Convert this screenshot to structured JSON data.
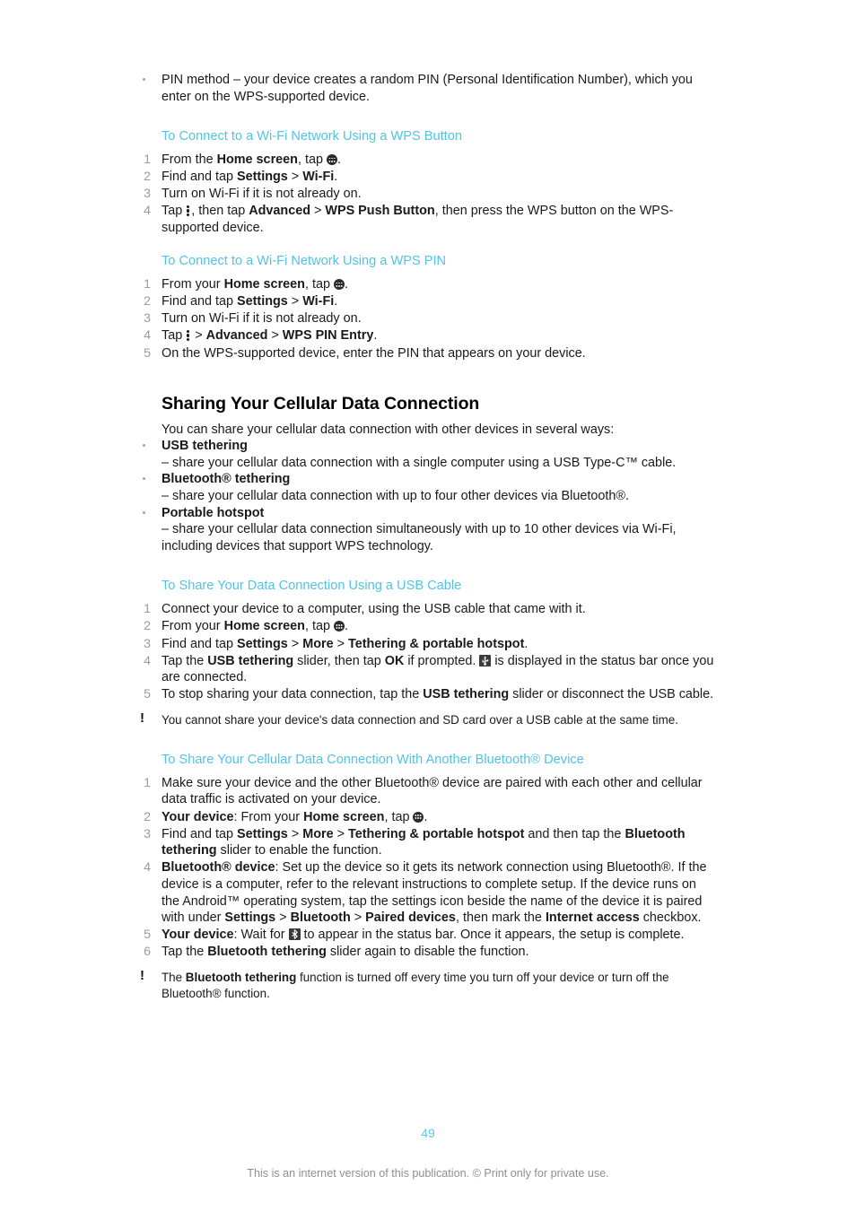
{
  "page": {
    "number": "49",
    "footer_note": "This is an internet version of this publication. © Print only for private use."
  },
  "top_bullet": {
    "text_part1": "PIN method – your device creates a random PIN (Personal Identification Number), which you enter on the WPS-supported device."
  },
  "section_wps_button": {
    "heading": "To Connect to a Wi-Fi Network Using a WPS Button",
    "steps": [
      {
        "num": "1",
        "parts": [
          {
            "t": "From the ",
            "b": false
          },
          {
            "t": "Home screen",
            "b": true
          },
          {
            "t": ", tap ",
            "b": false
          },
          {
            "icon": "app-drawer-icon"
          },
          {
            "t": ".",
            "b": false
          }
        ]
      },
      {
        "num": "2",
        "parts": [
          {
            "t": "Find and tap ",
            "b": false
          },
          {
            "t": "Settings",
            "b": true
          },
          {
            "t": " > ",
            "b": false
          },
          {
            "t": "Wi-Fi",
            "b": true
          },
          {
            "t": ".",
            "b": false
          }
        ]
      },
      {
        "num": "3",
        "parts": [
          {
            "t": "Turn on Wi-Fi if it is not already on.",
            "b": false
          }
        ]
      },
      {
        "num": "4",
        "parts": [
          {
            "t": "Tap ",
            "b": false
          },
          {
            "icon": "overflow-menu-icon"
          },
          {
            "t": ", then tap ",
            "b": false
          },
          {
            "t": "Advanced",
            "b": true
          },
          {
            "t": " > ",
            "b": false
          },
          {
            "t": "WPS Push Button",
            "b": true
          },
          {
            "t": ", then press the WPS button on the WPS-supported device.",
            "b": false
          }
        ]
      }
    ]
  },
  "section_wps_pin": {
    "heading": "To Connect to a Wi-Fi Network Using a WPS PIN",
    "steps": [
      {
        "num": "1",
        "parts": [
          {
            "t": "From your ",
            "b": false
          },
          {
            "t": "Home screen",
            "b": true
          },
          {
            "t": ", tap ",
            "b": false
          },
          {
            "icon": "app-drawer-icon"
          },
          {
            "t": ".",
            "b": false
          }
        ]
      },
      {
        "num": "2",
        "parts": [
          {
            "t": "Find and tap ",
            "b": false
          },
          {
            "t": "Settings",
            "b": true
          },
          {
            "t": " > ",
            "b": false
          },
          {
            "t": "Wi-Fi",
            "b": true
          },
          {
            "t": ".",
            "b": false
          }
        ]
      },
      {
        "num": "3",
        "parts": [
          {
            "t": "Turn on Wi-Fi if it is not already on.",
            "b": false
          }
        ]
      },
      {
        "num": "4",
        "parts": [
          {
            "t": "Tap ",
            "b": false
          },
          {
            "icon": "overflow-menu-icon"
          },
          {
            "t": " > ",
            "b": false
          },
          {
            "t": "Advanced",
            "b": true
          },
          {
            "t": " > ",
            "b": false
          },
          {
            "t": "WPS PIN Entry",
            "b": true
          },
          {
            "t": ".",
            "b": false
          }
        ]
      },
      {
        "num": "5",
        "parts": [
          {
            "t": "On the WPS-supported device, enter the PIN that appears on your device.",
            "b": false
          }
        ]
      }
    ]
  },
  "section_sharing": {
    "title": "Sharing Your Cellular Data Connection",
    "intro": "You can share your cellular data connection with other devices in several ways:",
    "bullets": [
      {
        "term": "USB tethering",
        "desc": "– share your cellular data connection with a single computer using a USB Type-C™ cable."
      },
      {
        "term": "Bluetooth® tethering",
        "desc": "– share your cellular data connection with up to four other devices via Bluetooth®."
      },
      {
        "term": "Portable hotspot",
        "desc": "– share your cellular data connection simultaneously with up to 10 other devices via Wi-Fi, including devices that support WPS technology."
      }
    ]
  },
  "section_usb": {
    "heading": "To Share Your Data Connection Using a USB Cable",
    "steps": [
      {
        "num": "1",
        "parts": [
          {
            "t": "Connect your device to a computer, using the USB cable that came with it.",
            "b": false
          }
        ]
      },
      {
        "num": "2",
        "parts": [
          {
            "t": "From your ",
            "b": false
          },
          {
            "t": "Home screen",
            "b": true
          },
          {
            "t": ", tap ",
            "b": false
          },
          {
            "icon": "app-drawer-icon"
          },
          {
            "t": ".",
            "b": false
          }
        ]
      },
      {
        "num": "3",
        "parts": [
          {
            "t": "Find and tap ",
            "b": false
          },
          {
            "t": "Settings",
            "b": true
          },
          {
            "t": " > ",
            "b": false
          },
          {
            "t": "More",
            "b": true
          },
          {
            "t": " > ",
            "b": false
          },
          {
            "t": "Tethering & portable hotspot",
            "b": true
          },
          {
            "t": ".",
            "b": false
          }
        ]
      },
      {
        "num": "4",
        "parts": [
          {
            "t": "Tap the ",
            "b": false
          },
          {
            "t": "USB tethering",
            "b": true
          },
          {
            "t": " slider, then tap ",
            "b": false
          },
          {
            "t": "OK",
            "b": true
          },
          {
            "t": " if prompted. ",
            "b": false
          },
          {
            "icon": "usb-status-icon"
          },
          {
            "t": " is displayed in the status bar once you are connected.",
            "b": false
          }
        ]
      },
      {
        "num": "5",
        "parts": [
          {
            "t": "To stop sharing your data connection, tap the ",
            "b": false
          },
          {
            "t": "USB tethering",
            "b": true
          },
          {
            "t": " slider or disconnect the USB cable.",
            "b": false
          }
        ]
      }
    ],
    "note": {
      "marker": "!",
      "parts": [
        {
          "t": "You cannot share your device's data connection and SD card over a USB cable at the same time.",
          "b": false
        }
      ]
    }
  },
  "section_bluetooth": {
    "heading": "To Share Your Cellular Data Connection With Another Bluetooth® Device",
    "steps": [
      {
        "num": "1",
        "parts": [
          {
            "t": "Make sure your device and the other Bluetooth® device are paired with each other and cellular data traffic is activated on your device.",
            "b": false
          }
        ]
      },
      {
        "num": "2",
        "parts": [
          {
            "t": "Your device",
            "b": true
          },
          {
            "t": ": From your ",
            "b": false
          },
          {
            "t": "Home screen",
            "b": true
          },
          {
            "t": ", tap ",
            "b": false
          },
          {
            "icon": "app-drawer-icon"
          },
          {
            "t": ".",
            "b": false
          }
        ]
      },
      {
        "num": "3",
        "parts": [
          {
            "t": "Find and tap ",
            "b": false
          },
          {
            "t": "Settings",
            "b": true
          },
          {
            "t": " > ",
            "b": false
          },
          {
            "t": "More",
            "b": true
          },
          {
            "t": " > ",
            "b": false
          },
          {
            "t": "Tethering & portable hotspot",
            "b": true
          },
          {
            "t": " and then tap the ",
            "b": false
          },
          {
            "t": "Bluetooth tethering",
            "b": true
          },
          {
            "t": " slider to enable the function.",
            "b": false
          }
        ]
      },
      {
        "num": "4",
        "parts": [
          {
            "t": "Bluetooth® device",
            "b": true
          },
          {
            "t": ": Set up the device so it gets its network connection using Bluetooth®. If the device is a computer, refer to the relevant instructions to complete setup. If the device runs on the Android™ operating system, tap the settings icon beside the name of the device it is paired with under ",
            "b": false
          },
          {
            "t": "Settings",
            "b": true
          },
          {
            "t": " > ",
            "b": false
          },
          {
            "t": "Bluetooth",
            "b": true
          },
          {
            "t": " > ",
            "b": false
          },
          {
            "t": "Paired devices",
            "b": true
          },
          {
            "t": ", then mark the ",
            "b": false
          },
          {
            "t": "Internet access",
            "b": true
          },
          {
            "t": " checkbox.",
            "b": false
          }
        ]
      },
      {
        "num": "5",
        "parts": [
          {
            "t": "Your device",
            "b": true
          },
          {
            "t": ": Wait for ",
            "b": false
          },
          {
            "icon": "bluetooth-status-icon"
          },
          {
            "t": " to appear in the status bar. Once it appears, the setup is complete.",
            "b": false
          }
        ]
      },
      {
        "num": "6",
        "parts": [
          {
            "t": "Tap the ",
            "b": false
          },
          {
            "t": "Bluetooth tethering",
            "b": true
          },
          {
            "t": " slider again to disable the function.",
            "b": false
          }
        ]
      }
    ],
    "note": {
      "marker": "!",
      "parts": [
        {
          "t": "The ",
          "b": false
        },
        {
          "t": "Bluetooth tethering",
          "b": true
        },
        {
          "t": " function is turned off every time you turn off your device or turn off the Bluetooth® function.",
          "b": false
        }
      ]
    }
  },
  "colors": {
    "heading_teal": "#51c3e7",
    "list_number_gray": "#9b9b9b",
    "body_black": "#1a1a1a",
    "footer_gray": "#8f8f8f"
  }
}
